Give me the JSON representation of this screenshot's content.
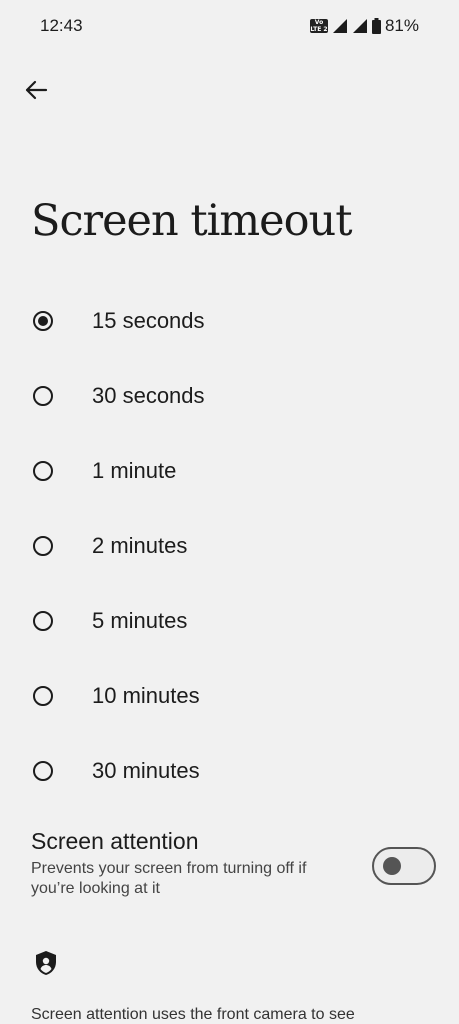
{
  "status_bar": {
    "time": "12:43",
    "volte_top": "Vo",
    "volte_bottom": "LTE 2",
    "battery": "81%"
  },
  "page": {
    "title": "Screen timeout"
  },
  "options": [
    {
      "label": "15 seconds",
      "selected": true
    },
    {
      "label": "30 seconds",
      "selected": false
    },
    {
      "label": "1 minute",
      "selected": false
    },
    {
      "label": "2 minutes",
      "selected": false
    },
    {
      "label": "5 minutes",
      "selected": false
    },
    {
      "label": "10 minutes",
      "selected": false
    },
    {
      "label": "30 minutes",
      "selected": false
    }
  ],
  "attention": {
    "title": "Screen attention",
    "subtitle": "Prevents your screen from turning off if you’re looking at it",
    "enabled": false
  },
  "footer": {
    "text": "Screen attention uses the front camera to see"
  }
}
